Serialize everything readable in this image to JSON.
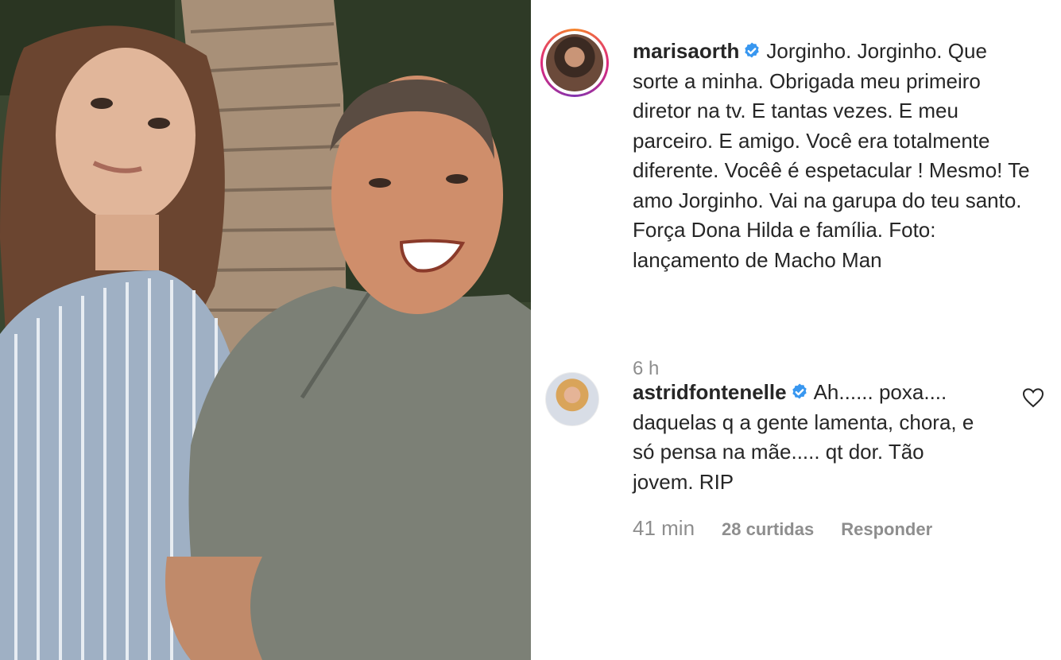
{
  "post": {
    "username": "marisaorth",
    "caption": "Jorginho. Jorginho. Que sorte a minha. Obrigada meu primeiro diretor na tv. E tantas vezes. E meu parceiro. E amigo. Você era totalmente diferente. Vocêê é espetacular ! Mesmo! Te amo Jorginho. Vai na garupa do teu santo. Força Dona Hilda e família. Foto: lançamento de Macho Man",
    "time": "6 h"
  },
  "comment": {
    "username": "astridfontenelle",
    "text": "Ah...... poxa.... daquelas q a gente lamenta, chora, e só pensa na mãe..... qt dor. Tão jovem. RIP",
    "time": "41 min",
    "likes": "28 curtidas",
    "reply_label": "Responder"
  },
  "icons": {
    "verified": "verified-badge-icon",
    "like": "heart-outline-icon"
  },
  "colors": {
    "verified": "#3897f0",
    "secondary_text": "#8e8e8e",
    "primary_text": "#262626",
    "story_ring_start": "#f58529",
    "story_ring_end": "#dd2a7b"
  }
}
